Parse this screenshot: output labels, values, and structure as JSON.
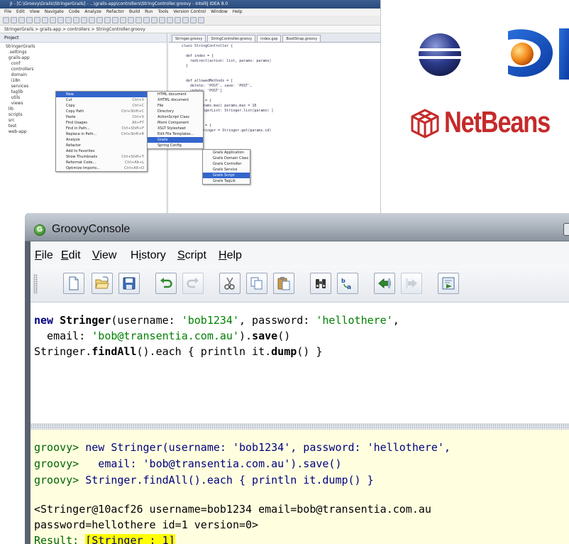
{
  "ide": {
    "title": "JI - [C:\\Groovy\\Grails\\StringerGrails] - ...\\grails-app\\controllers\\StringController.groovy - IntelliJ IDEA 8.0",
    "menu": [
      "File",
      "Edit",
      "View",
      "Navigate",
      "Code",
      "Analyze",
      "Refactor",
      "Build",
      "Run",
      "Tools",
      "Version Control",
      "Window",
      "Help"
    ],
    "breadcrumb": "StringerGrails > grails-app > controllers > StringController.groovy",
    "project_label": "Project",
    "editor_tabs": [
      "Stringer.groovy",
      "StringController.groovy",
      "index.gsp",
      "BootStrap.groovy"
    ],
    "code_lines": [
      "class StringController {",
      "",
      "  def index = {",
      "    redirect(action: list, params: params)",
      "  }",
      "",
      "",
      "  def allowedMethods = [",
      "    delete: 'POST', save: 'POST',",
      "    update: 'POST']",
      "",
      "  def list = {",
      "    if(!params.max) params.max = 10",
      "    [ stringerList: Stringer.list(params) ]",
      "  }",
      "",
      "  def show = {",
      "    def stringer = Stringer.get(params.id)",
      "  }"
    ],
    "tree_lines": [
      "StringerGrails",
      "  .settings",
      "  grails-app",
      "    conf",
      "    controllers",
      "    domain",
      "    i18n",
      "    services",
      "    taglib",
      "    utils",
      "    views",
      "  lib",
      "  scripts",
      "  src",
      "  test",
      "  web-app"
    ],
    "context_menu": [
      {
        "label": "New",
        "shortcut": "",
        "selected": true
      },
      {
        "label": "Cut",
        "shortcut": "Ctrl+X"
      },
      {
        "label": "Copy",
        "shortcut": "Ctrl+C"
      },
      {
        "label": "Copy Path",
        "shortcut": "Ctrl+Shift+C"
      },
      {
        "label": "Paste",
        "shortcut": "Ctrl+V"
      },
      {
        "label": "Find Usages",
        "shortcut": "Alt+F7"
      },
      {
        "label": "Find in Path...",
        "shortcut": "Ctrl+Shift+F"
      },
      {
        "label": "Replace in Path...",
        "shortcut": "Ctrl+Shift+R"
      },
      {
        "label": "Analyze",
        "shortcut": ""
      },
      {
        "label": "Refactor",
        "shortcut": ""
      },
      {
        "label": "Add to Favorites",
        "shortcut": ""
      },
      {
        "label": "Show Thumbnails",
        "shortcut": "Ctrl+Shift+T"
      },
      {
        "label": "Reformat Code...",
        "shortcut": "Ctrl+Alt+L"
      },
      {
        "label": "Optimize Imports...",
        "shortcut": "Ctrl+Alt+O"
      }
    ],
    "new_submenu": [
      {
        "label": "HTML document"
      },
      {
        "label": "XHTML document"
      },
      {
        "label": "File"
      },
      {
        "label": "Directory"
      },
      {
        "label": "ActionScript Class"
      },
      {
        "label": "Mxml Component"
      },
      {
        "label": "XSLT Stylesheet"
      },
      {
        "label": "Edit File Templates..."
      },
      {
        "label": "Grails",
        "selected": true
      },
      {
        "label": "Spring Config"
      }
    ],
    "grails_submenu": [
      {
        "label": "Grails Application"
      },
      {
        "label": "Grails Domain Class"
      },
      {
        "label": "Grails Controller"
      },
      {
        "label": "Grails Service"
      },
      {
        "label": "Grails Script",
        "selected": true
      },
      {
        "label": "Grails TagLib"
      }
    ]
  },
  "logos": {
    "netbeans": "NetBeans"
  },
  "console": {
    "title": "GroovyConsole",
    "menus": [
      {
        "label": "File",
        "mnemonic": "F",
        "rest": "ile"
      },
      {
        "label": "Edit",
        "mnemonic": "E",
        "rest": "dit"
      },
      {
        "label": "View",
        "mnemonic": "V",
        "rest": "iew"
      },
      {
        "label": "History",
        "mnemonic": "i",
        "pre": "H",
        "rest": "story"
      },
      {
        "label": "Script",
        "mnemonic": "S",
        "rest": "cript"
      },
      {
        "label": "Help",
        "mnemonic": "H",
        "rest": "elp"
      }
    ],
    "toolbar": [
      "new-file",
      "open-file",
      "save-file",
      "undo",
      "redo",
      "cut",
      "copy",
      "paste",
      "find",
      "replace",
      "history-previous",
      "history-next",
      "run-script"
    ],
    "input": {
      "line1": {
        "kw": "new",
        "cls": "Stringer",
        "a": "(username: ",
        "s1": "'bob1234'",
        "b": ", password: ",
        "s2": "'hellothere'",
        "c": ","
      },
      "line2": {
        "a": "  email: ",
        "s1": "'bob@transentia.com.au'",
        "b": ").",
        "meth": "save",
        "c": "()"
      },
      "line3": {
        "a": "Stringer.",
        "meth1": "findAll",
        "b": "().each { println it.",
        "meth2": "dump",
        "c": "() }"
      }
    },
    "output": {
      "prompt": "groovy>",
      "echo": [
        " new Stringer(username: 'bob1234', password: 'hellothere',",
        "   email: 'bob@transentia.com.au').save()",
        " Stringer.findAll().each { println it.dump() }"
      ],
      "dump_line1": "<Stringer@10acf26 username=bob1234 email=bob@transentia.com.au",
      "dump_line2": "password=hellothere id=1 version=0>",
      "result_label": "Result: ",
      "result_value": "[Stringer : 1]"
    }
  }
}
